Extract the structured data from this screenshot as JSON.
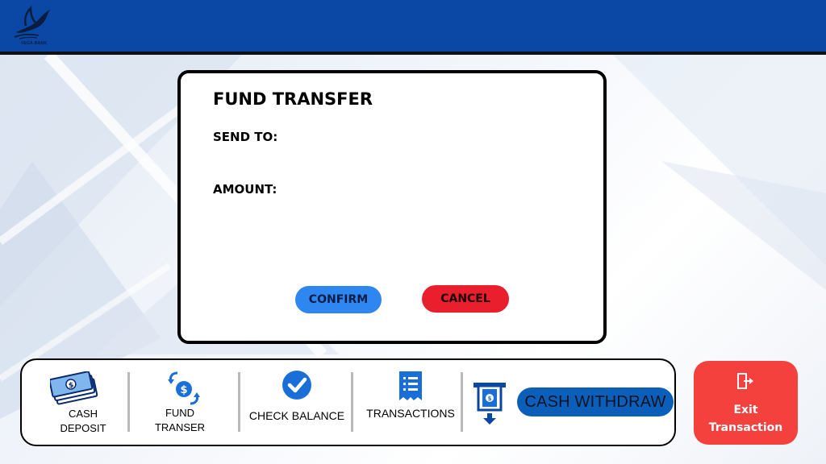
{
  "brand": {
    "logo_text": "VEGA BANK",
    "colors": {
      "primary": "#0b47a4",
      "accent_red": "#f5413d"
    }
  },
  "modal": {
    "title": "FUND TRANSFER",
    "send_to_label": "SEND TO:",
    "amount_label": "AMOUNT:",
    "confirm_label": "CONFIRM",
    "cancel_label": "CANCEL"
  },
  "menu": {
    "cash_deposit": {
      "line1": "CASH",
      "line2": "DEPOSIT",
      "icon": "cash-stack-icon"
    },
    "fund_transfer": {
      "line1": "FUND",
      "line2": "TRANSER",
      "icon": "money-transfer-icon"
    },
    "check_balance": {
      "label": "CHECK BALANCE",
      "icon": "check-circle-icon"
    },
    "transactions": {
      "label": "TRANSACTIONS",
      "icon": "receipt-icon"
    },
    "cash_withdraw": {
      "label": "CASH WITHDRAW",
      "icon": "atm-withdraw-icon"
    }
  },
  "exit": {
    "line1": "Exit",
    "line2": "Transaction",
    "icon": "exit-door-icon"
  }
}
